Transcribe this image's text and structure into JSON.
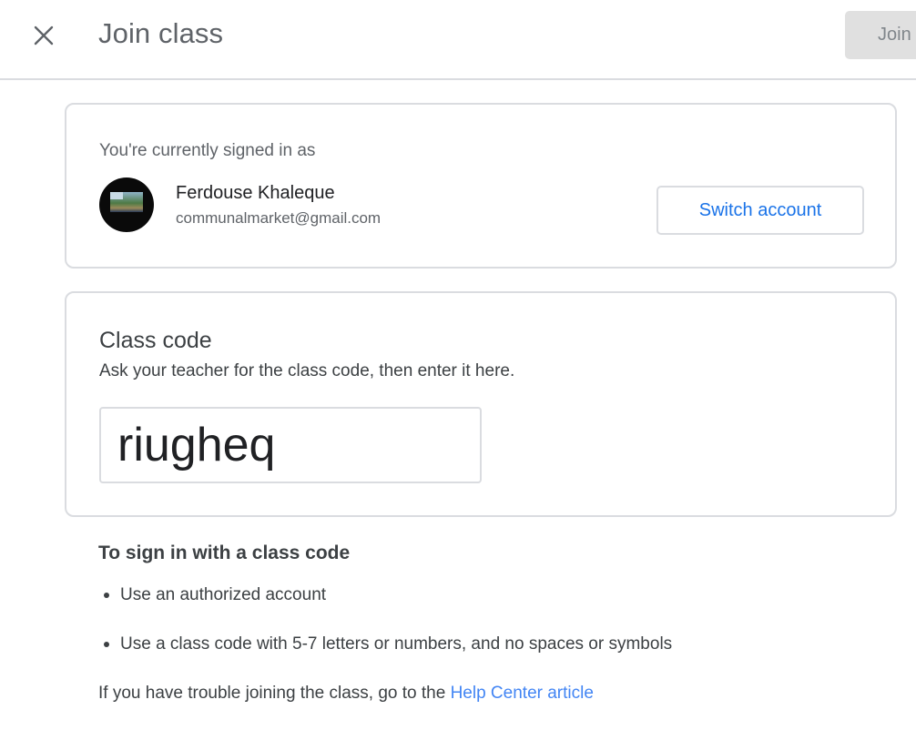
{
  "header": {
    "title": "Join class",
    "close_icon": "close-icon",
    "join_label": "Join"
  },
  "account": {
    "signed_in_label": "You're currently signed in as",
    "name": "Ferdouse Khaleque",
    "email": "communalmarket@gmail.com",
    "switch_label": "Switch account"
  },
  "class_code": {
    "title": "Class code",
    "description": "Ask your teacher for the class code, then enter it here.",
    "value": "riugheq",
    "placeholder": ""
  },
  "help": {
    "title": "To sign in with a class code",
    "bullets": [
      "Use an authorized account",
      "Use a class code with 5-7 letters or numbers, and no spaces or symbols"
    ],
    "trouble_text": "If you have trouble joining the class, go to the ",
    "link_label": "Help Center article"
  },
  "colors": {
    "accent": "#1a73e8",
    "link": "#4285f4",
    "border": "#dadce0",
    "disabled_button": "#e0e0e0"
  }
}
